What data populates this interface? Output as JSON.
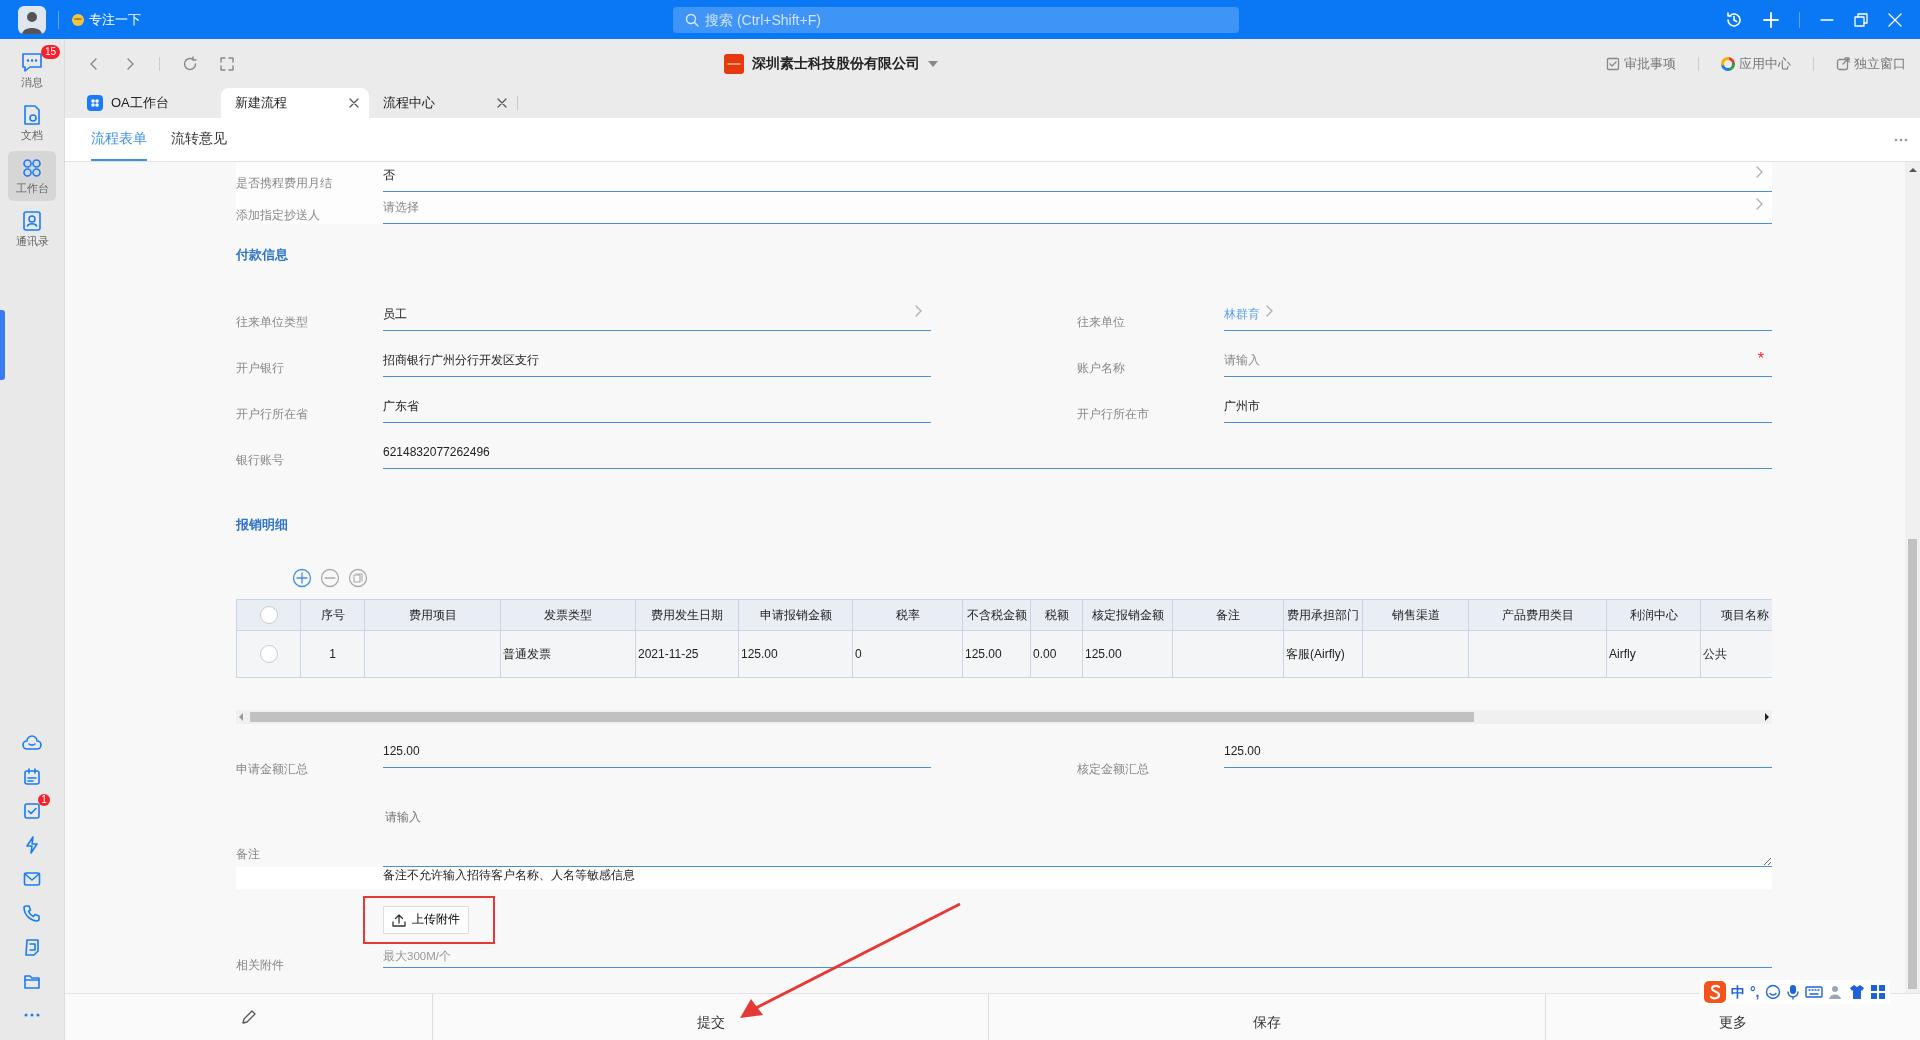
{
  "top_bar": {
    "status": "专注一下",
    "search": {
      "placeholder": "搜索 (Ctrl+Shift+F)"
    }
  },
  "sidebar": {
    "items": [
      {
        "kind": "chat",
        "label": "消息",
        "badge": "15",
        "selected": false
      },
      {
        "kind": "doc",
        "label": "文档",
        "selected": false
      },
      {
        "kind": "apps",
        "label": "工作台",
        "selected": true
      },
      {
        "kind": "contacts",
        "label": "通讯录",
        "selected": false
      }
    ],
    "tools": [
      {
        "kind": "cloud"
      },
      {
        "kind": "calendar"
      },
      {
        "kind": "task",
        "badge": "1"
      },
      {
        "kind": "flash"
      },
      {
        "kind": "mail"
      },
      {
        "kind": "phone"
      },
      {
        "kind": "note"
      },
      {
        "kind": "folder"
      },
      {
        "kind": "more"
      }
    ]
  },
  "toolbar": {
    "company": "深圳素士科技股份有限公司",
    "actions": [
      {
        "kind": "approve",
        "label": "审批事项"
      },
      {
        "kind": "apps",
        "label": "应用中心"
      },
      {
        "kind": "window",
        "label": "独立窗口"
      }
    ]
  },
  "tabs": [
    {
      "label": "OA工作台",
      "selected": false,
      "closable": false,
      "has_icon": true
    },
    {
      "label": "新建流程",
      "selected": true,
      "closable": true,
      "has_icon": false
    },
    {
      "label": "流程中心",
      "selected": false,
      "closable": true,
      "has_icon": false
    }
  ],
  "form_tabs": [
    {
      "label": "流程表单",
      "selected": true
    },
    {
      "label": "流转意见",
      "selected": false
    }
  ],
  "form": {
    "top_fields": [
      {
        "label": "是否携程费用月结",
        "value": "否"
      },
      {
        "label": "添加指定抄送人",
        "placeholder": "请选择"
      }
    ],
    "payment": {
      "title": "付款信息",
      "fields": [
        {
          "label": "往来单位类型",
          "value": "员工",
          "kind": "select"
        },
        {
          "label": "往来单位",
          "value": "林群育",
          "kind": "link"
        },
        {
          "label": "开户银行",
          "value": "招商银行广州分行开发区支行",
          "kind": "text"
        },
        {
          "label": "账户名称",
          "placeholder": "请输入",
          "kind": "text",
          "required_mark": "*"
        },
        {
          "label": "开户行所在省",
          "value": "广东省",
          "kind": "text"
        },
        {
          "label": "开户行所在市",
          "value": "广州市",
          "kind": "text"
        },
        {
          "label": "银行账号",
          "value": "6214832077262496",
          "kind": "wide"
        }
      ]
    },
    "details": {
      "title": "报销明细",
      "table": {
        "select_all": false,
        "columns": [
          "序号",
          "费用项目",
          "发票类型",
          "费用发生日期",
          "申请报销金额",
          "税率",
          "不含税金额",
          "税额",
          "核定报销金额",
          "备注",
          "费用承担部门",
          "销售渠道",
          "产品费用类目",
          "利润中心",
          "项目名称"
        ],
        "rows": [
          {
            "selected": false,
            "cells": [
              "1",
              null,
              "普通发票",
              "2021-11-25",
              "125.00",
              "0",
              "125.00",
              "0.00",
              "125.00",
              null,
              "客服(Airfly)",
              null,
              null,
              "Airfly",
              "公共"
            ]
          }
        ]
      },
      "totals": [
        {
          "label": "申请金额汇总",
          "value": "125.00"
        },
        {
          "label": "核定金额汇总",
          "value": "125.00"
        }
      ]
    },
    "remark": {
      "label": "备注",
      "placeholder": "请输入",
      "hint": "备注不允许输入招待客户名称、人名等敏感信息"
    },
    "attachment": {
      "label": "相关附件",
      "button": "上传附件",
      "hint": "最大300M/个"
    }
  },
  "actions": [
    "提交",
    "保存",
    "更多"
  ],
  "annotations": {
    "highlight_upload": true,
    "arrow_to_submit": true
  },
  "ime_toolbar": {
    "labels": [
      "中",
      "°,"
    ]
  }
}
